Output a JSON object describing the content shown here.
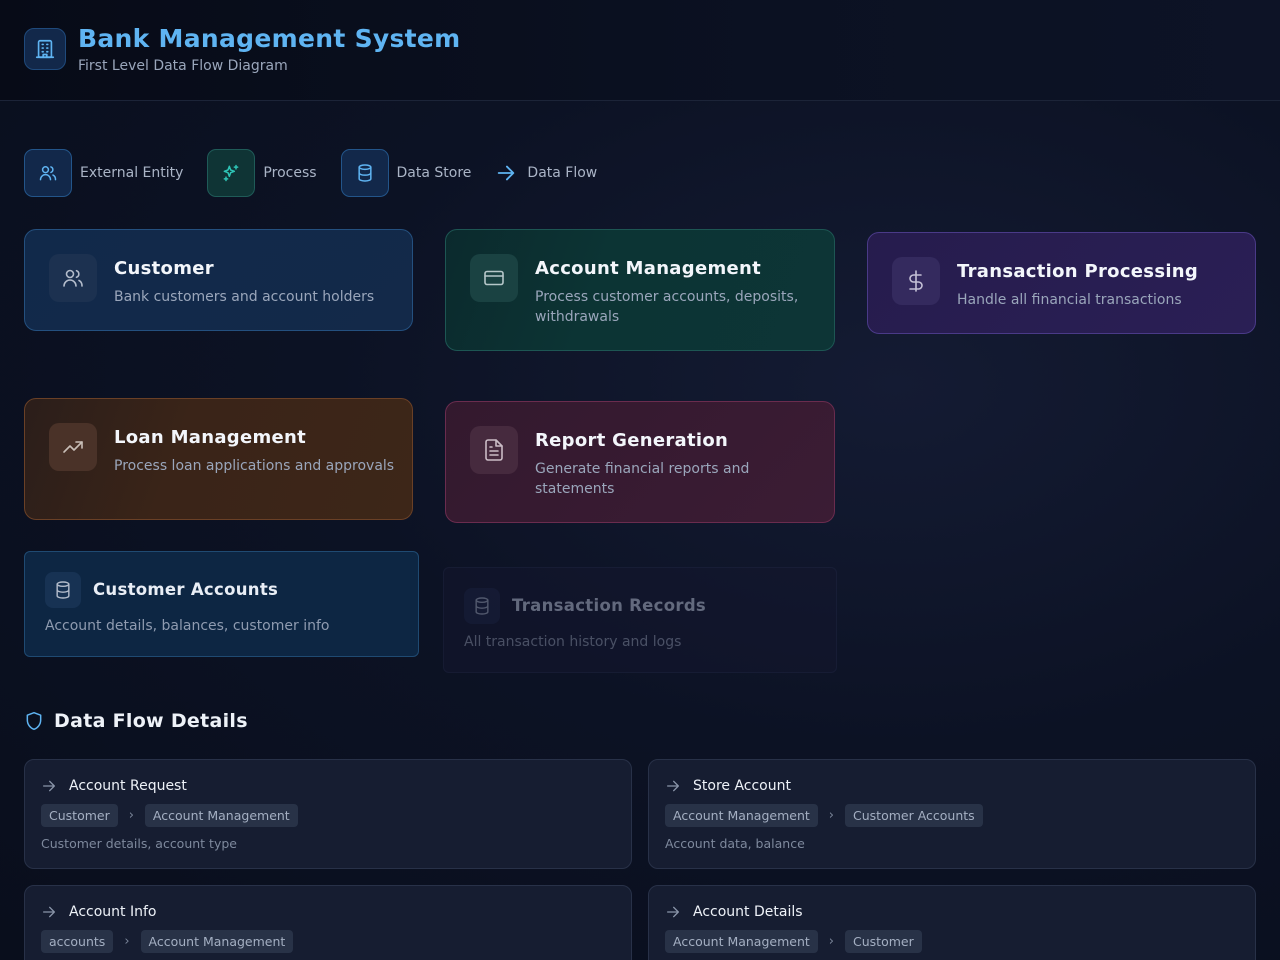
{
  "header": {
    "title": "Bank Management System",
    "subtitle": "First Level Data Flow Diagram"
  },
  "legend": {
    "external_entity": "External Entity",
    "process": "Process",
    "data_store": "Data Store",
    "data_flow": "Data Flow"
  },
  "nodes": {
    "customer": {
      "title": "Customer",
      "desc": "Bank customers and account holders"
    },
    "account_management": {
      "title": "Account Management",
      "desc": "Process customer accounts, deposits, withdrawals"
    },
    "transaction_processing": {
      "title": "Transaction Processing",
      "desc": "Handle all financial transactions"
    },
    "loan_management": {
      "title": "Loan Management",
      "desc": "Process loan applications and approvals"
    },
    "report_generation": {
      "title": "Report Generation",
      "desc": "Generate financial reports and statements"
    }
  },
  "stores": {
    "customer_accounts": {
      "title": "Customer Accounts",
      "desc": "Account details, balances, customer info"
    },
    "transaction_records": {
      "title": "Transaction Records",
      "desc": "All transaction history and logs"
    }
  },
  "details": {
    "title": "Data Flow Details",
    "flows": [
      {
        "label": "Account Request",
        "from": "Customer",
        "to": "Account Management",
        "desc": "Customer details, account type"
      },
      {
        "label": "Store Account",
        "from": "Account Management",
        "to": "Customer Accounts",
        "desc": "Account data, balance"
      },
      {
        "label": "Account Info",
        "from": "accounts",
        "to": "Account Management",
        "desc": ""
      },
      {
        "label": "Account Details",
        "from": "Account Management",
        "to": "Customer",
        "desc": ""
      }
    ]
  },
  "colors": {
    "accent_blue": "#5fb4f2",
    "entity": "#12284a",
    "process_teal": "#0c3434",
    "process_purple": "#291f52",
    "process_orange": "#3a2418",
    "process_rose": "#3a1b33",
    "store": "#0d2643"
  }
}
